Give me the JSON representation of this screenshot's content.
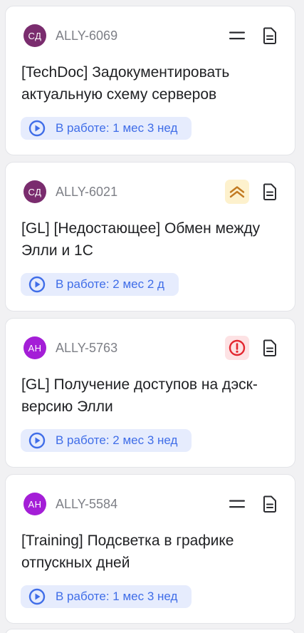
{
  "colors": {
    "status_text": "#3f6de8",
    "status_bg": "#e6ecfd",
    "priority_high_bg": "#fdf1cd",
    "priority_high_icon": "#c27a22",
    "priority_critical_bg": "#fde2e4",
    "priority_critical_icon": "#e3262f",
    "avatar_sd": "#7a2c6e",
    "avatar_an": "#a41ed7"
  },
  "cards": [
    {
      "avatar": "СД",
      "key": "ALLY-6069",
      "priority": "normal-icon",
      "title": "[TechDoc] Задокументировать актуальную схему серверов",
      "status": "В работе: 1 мес 3 нед"
    },
    {
      "avatar": "СД",
      "key": "ALLY-6021",
      "priority": "high-priority-icon",
      "title": "[GL] [Недостающее] Обмен между Элли и 1С",
      "status": "В работе: 2 мес 2 д"
    },
    {
      "avatar": "АН",
      "key": "ALLY-5763",
      "priority": "critical-priority-icon",
      "title": "[GL] Получение доступов на дэск-версию Элли",
      "status": "В работе: 2 мес 3 нед"
    },
    {
      "avatar": "АН",
      "key": "ALLY-5584",
      "priority": "normal-icon",
      "title": "[Training] Подсветка в графике отпускных дней",
      "status": "В работе: 1 мес 3 нед"
    }
  ]
}
